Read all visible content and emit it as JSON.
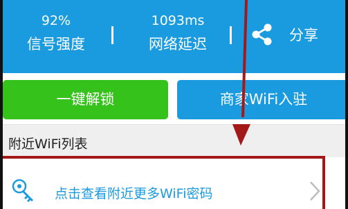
{
  "stats": {
    "signal": {
      "value": "92%",
      "label": "信号强度"
    },
    "latency": {
      "value": "1093ms",
      "label": "网络延迟"
    },
    "share_label": "分享"
  },
  "actions": {
    "unlock_label": "一键解锁",
    "merchant_label": "商家WiFi入驻"
  },
  "section": {
    "title": "附近WiFi列表"
  },
  "list": {
    "more_passwords_label": "点击查看附近更多WiFi密码"
  },
  "icons": {
    "share": "share-icon",
    "key": "key-icon",
    "chevron": "chevron-right-icon"
  },
  "colors": {
    "primary_blue": "#1a9bdf",
    "green": "#35c21a",
    "annotation_red": "#a31818"
  }
}
